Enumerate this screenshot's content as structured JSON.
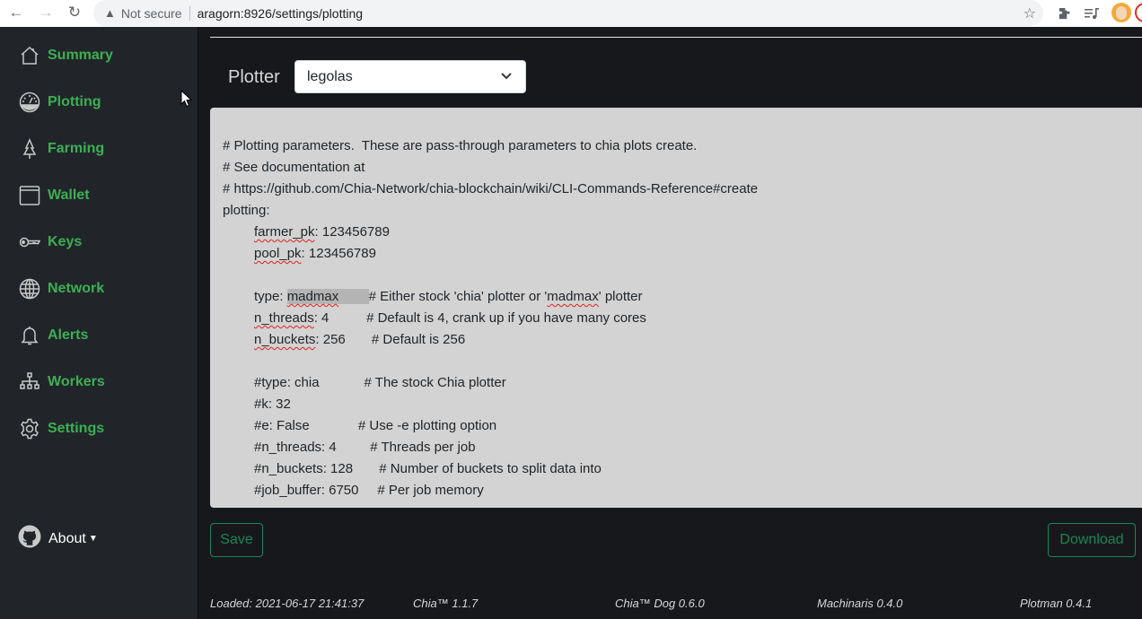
{
  "browser": {
    "security_label": "Not secure",
    "url": "aragorn:8926/settings/plotting"
  },
  "sidebar": {
    "items": [
      {
        "label": "Summary",
        "icon": "house-icon"
      },
      {
        "label": "Plotting",
        "icon": "speedometer-icon"
      },
      {
        "label": "Farming",
        "icon": "tree-icon"
      },
      {
        "label": "Wallet",
        "icon": "wallet-icon"
      },
      {
        "label": "Keys",
        "icon": "key-icon"
      },
      {
        "label": "Network",
        "icon": "globe-icon"
      },
      {
        "label": "Alerts",
        "icon": "bell-icon"
      },
      {
        "label": "Workers",
        "icon": "diagram-icon"
      },
      {
        "label": "Settings",
        "icon": "gear-icon"
      }
    ],
    "about_label": "About"
  },
  "main": {
    "plotter_label": "Plotter",
    "plotter_selected": "legolas",
    "editor_lines": {
      "l1": "# Plotting parameters.  These are pass-through parameters to chia plots create.",
      "l2": "# See documentation at",
      "l3": "# https://github.com/Chia-Network/chia-blockchain/wiki/CLI-Commands-Reference#create",
      "l4": "plotting:",
      "farmer_pk_key": "farmer_pk",
      "farmer_pk_val": ": 123456789",
      "pool_pk_key": "pool_pk",
      "pool_pk_val": ": 123456789",
      "type_key": "type: ",
      "type_val": "madmax",
      "type_pad": "        ",
      "type_comment_a": "# Either stock 'chia' plotter or '",
      "type_comment_word": "madmax",
      "type_comment_b": "' plotter",
      "n_threads_key": "n_threads",
      "n_threads_val": ": 4          # Default is 4, crank up if you have many cores",
      "n_buckets_key": "n_buckets",
      "n_buckets_val": ": 256       # Default is 256",
      "c1": "#type: chia            # The stock Chia plotter",
      "c2": "#k: 32",
      "c3": "#e: False             # Use -e plotting option",
      "c4": "#n_threads: 4         # Threads per job",
      "c5": "#n_buckets: 128       # Number of buckets to split data into",
      "c6": "#job_buffer: 6750     # Per job memory"
    },
    "save_label": "Save",
    "download_label": "Download"
  },
  "footer": {
    "loaded": "Loaded: 2021-06-17 21:41:37",
    "chia": "Chia™ 1.1.7",
    "chiadog": "Chia™ Dog 0.6.0",
    "machinaris": "Machinaris 0.4.0",
    "plotman": "Plotman 0.4.1"
  },
  "colors": {
    "accent_green": "#3cb054",
    "button_green": "#198754",
    "sidebar_bg": "#212529",
    "main_bg": "#17181c",
    "editor_bg": "#d3d3d3"
  }
}
